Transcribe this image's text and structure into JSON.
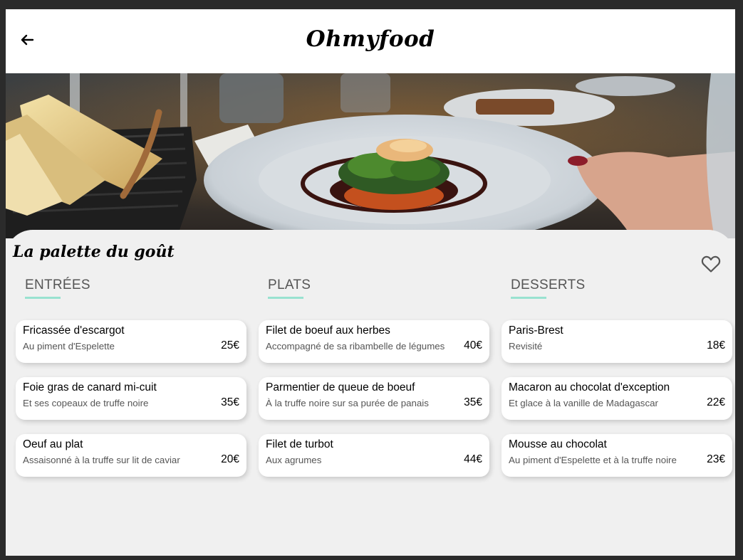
{
  "header": {
    "brand": "Ohmyfood",
    "back_icon": "arrow-left-icon"
  },
  "restaurant": {
    "name": "La palette du goût",
    "like_icon": "heart-outline-icon"
  },
  "colors": {
    "accent": "#99e2d0",
    "background": "#f0f0f0",
    "card": "#ffffff",
    "header": "#ffffff"
  },
  "menu": {
    "sections": [
      {
        "title": "ENTRÉES",
        "dishes": [
          {
            "name": "Fricassée d'escargot",
            "description": "Au piment d'Espelette",
            "price": "25€"
          },
          {
            "name": "Foie gras de canard mi-cuit",
            "description": "Et ses copeaux de truffe noire",
            "price": "35€"
          },
          {
            "name": "Oeuf au plat",
            "description": "Assaisonné à la truffe sur lit de caviar",
            "price": "20€"
          }
        ]
      },
      {
        "title": "PLATS",
        "dishes": [
          {
            "name": "Filet de boeuf aux herbes",
            "description": "Accompagné de sa ribambelle de légumes",
            "price": "40€"
          },
          {
            "name": "Parmentier de queue de boeuf",
            "description": "À la truffe noire sur sa purée de panais",
            "price": "35€"
          },
          {
            "name": "Filet de turbot",
            "description": "Aux agrumes",
            "price": "44€"
          }
        ]
      },
      {
        "title": "DESSERTS",
        "dishes": [
          {
            "name": "Paris-Brest",
            "description": "Revisité",
            "price": "18€"
          },
          {
            "name": "Macaron au chocolat d'exception",
            "description": "Et glace à la vanille de Madagascar",
            "price": "22€"
          },
          {
            "name": "Mousse au chocolat",
            "description": "Au piment d'Espelette et à la truffe noire",
            "price": "23€"
          }
        ]
      }
    ]
  }
}
